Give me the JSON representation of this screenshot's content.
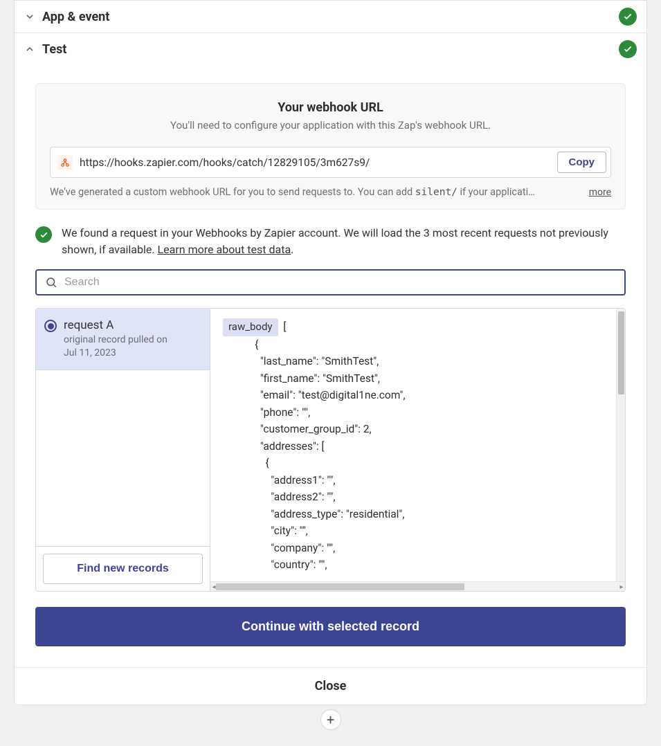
{
  "sections": {
    "appEvent": {
      "title": "App & event",
      "complete": true
    },
    "test": {
      "title": "Test",
      "complete": true
    }
  },
  "webhook": {
    "title": "Your webhook URL",
    "subtitle": "You'll need to configure your application with this Zap's webhook URL.",
    "url": "https://hooks.zapier.com/hooks/catch/12829105/3m627s9/",
    "copy_label": "Copy",
    "generated_prefix": "We've generated a custom webhook URL for you to send requests to. You can add ",
    "generated_code": "silent/",
    "generated_suffix": " if your applicati…",
    "more_label": "more"
  },
  "found": {
    "text_prefix": "We found a request in your Webhooks by Zapier account. We will load the 3 most recent requests not previously shown, if available. ",
    "link_text": "Learn more about test data",
    "period": "."
  },
  "search": {
    "placeholder": "Search"
  },
  "records": {
    "selected": {
      "title": "request A",
      "sub_line1": "original record pulled on",
      "sub_line2": "Jul 11, 2023"
    },
    "find_label": "Find new records",
    "body_tag": "raw_body",
    "body_lines": [
      "[",
      "  {",
      "    \"last_name\": \"SmithTest\",",
      "    \"first_name\": \"SmithTest\",",
      "    \"email\": \"test@digital1ne.com\",",
      "    \"phone\": \"\",",
      "    \"customer_group_id\": 2,",
      "    \"addresses\": [",
      "      {",
      "        \"address1\": \"\",",
      "        \"address2\": \"\",",
      "        \"address_type\": \"residential\",",
      "        \"city\": \"\",",
      "        \"company\": \"\",",
      "        \"country\": \"\","
    ]
  },
  "continue_label": "Continue with selected record",
  "close_label": "Close"
}
